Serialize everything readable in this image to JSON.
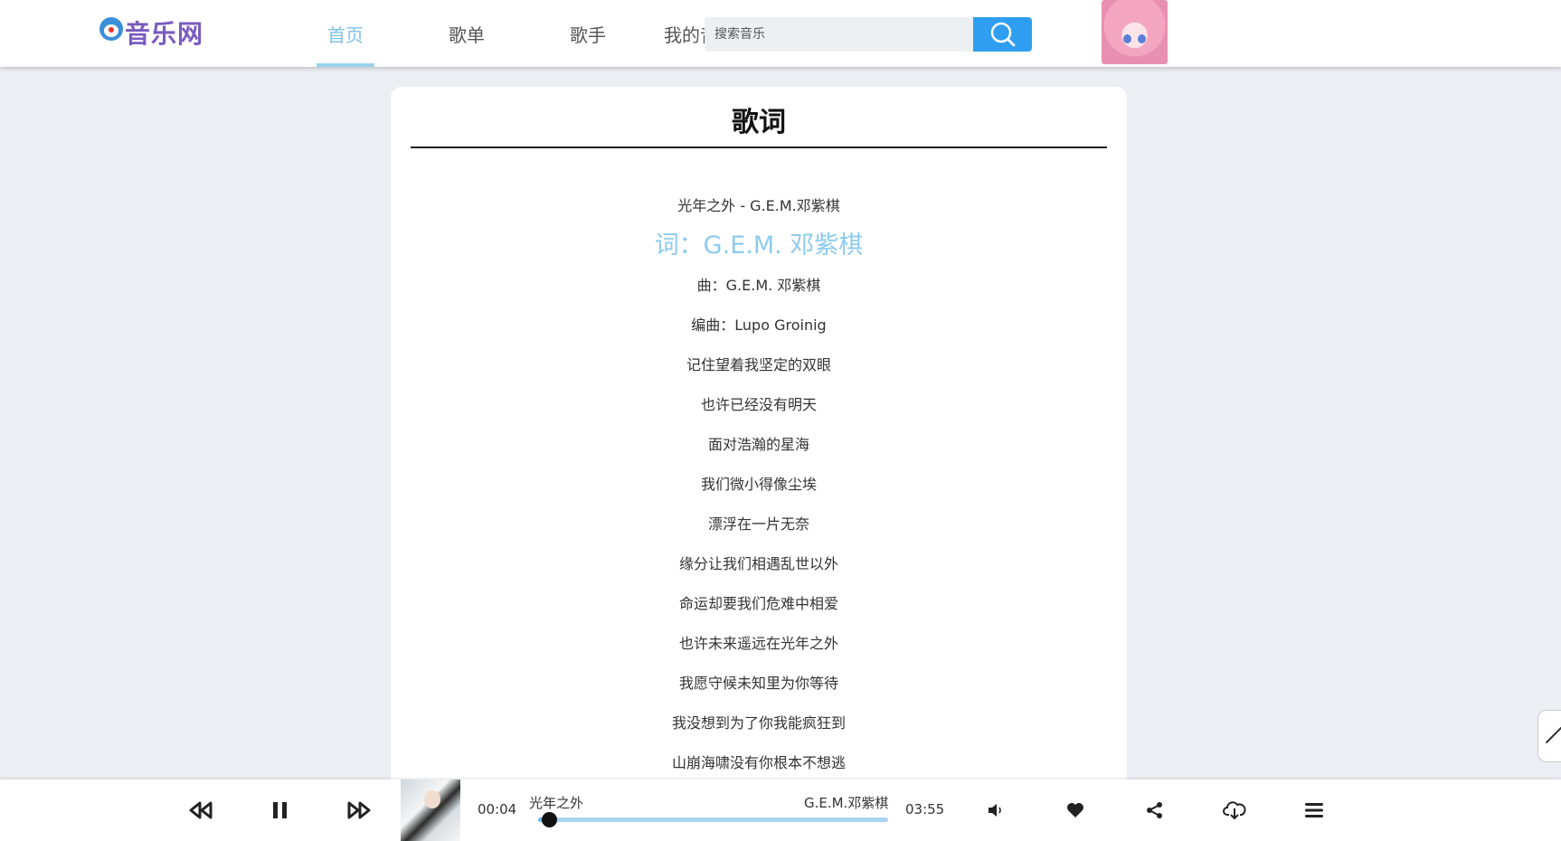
{
  "header": {
    "logo_text": "音乐网",
    "nav": [
      "首页",
      "歌单",
      "歌手",
      "我的音乐"
    ],
    "active_nav": "首页",
    "search": {
      "placeholder": "搜索音乐",
      "value": ""
    }
  },
  "lyrics_panel": {
    "title": "歌词",
    "lines": [
      "光年之外 - G.E.M.邓紫棋",
      "词：G.E.M. 邓紫棋",
      "曲：G.E.M. 邓紫棋",
      "编曲：Lupo Groinig",
      "记住望着我坚定的双眼",
      "也许已经没有明天",
      "面对浩瀚的星海",
      "我们微小得像尘埃",
      "漂浮在一片无奈",
      "缘分让我们相遇乱世以外",
      "命运却要我们危难中相爱",
      "也许未来遥远在光年之外",
      "我愿守候未知里为你等待",
      "我没想到为了你我能疯狂到",
      "山崩海啸没有你根本不想逃"
    ],
    "current_line_index": 1
  },
  "player": {
    "current_time": "00:04",
    "song_title": "光年之外",
    "artist": "G.E.M.邓紫棋",
    "duration": "03:55",
    "progress": 0.03,
    "is_playing": true
  },
  "icons": [
    "logo-icon",
    "search-icon",
    "rewind-icon",
    "pause-icon",
    "fast-forward-icon",
    "volume-icon",
    "heart-icon",
    "share-icon",
    "cloud-download-icon",
    "menu-icon",
    "back-to-top-icon"
  ],
  "colors": {
    "accent": "#2f9ef0",
    "active_nav": "#7cc2ea",
    "highlight_lyric": "#8ccbee",
    "logo": "#7a5bbf"
  }
}
